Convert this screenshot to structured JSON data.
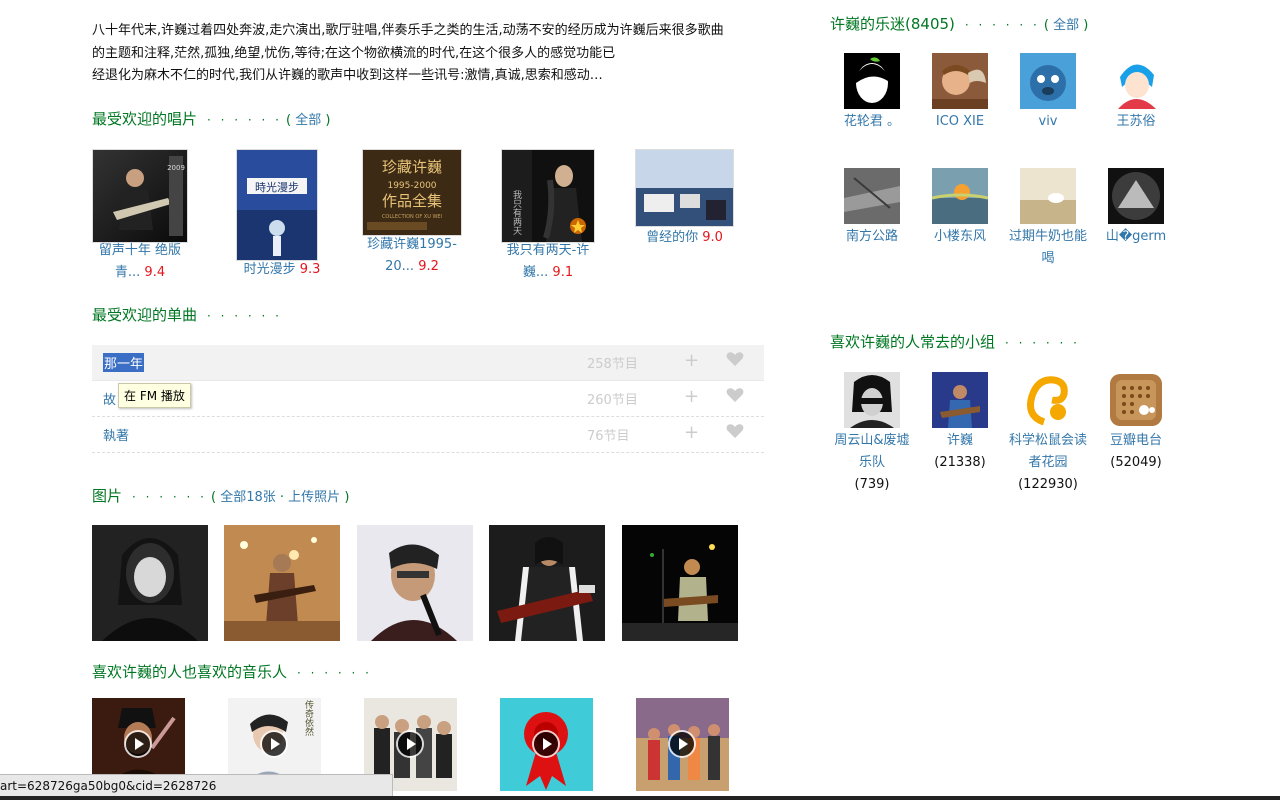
{
  "intro": {
    "line1": "八十年代末,许巍过着四处奔波,走穴演出,歌厅驻唱,伴奏乐手之类的生活,动荡不安的经历成为许巍后来很多歌曲",
    "line2": "的主题和注释,茫然,孤独,绝望,忧伤,等待;在这个物欲横流的时代,在这个很多人的感觉功能已",
    "line3": "经退化为麻木不仁的时代,我们从许巍的歌声中收到这样一些讯号:激情,真诚,思索和感动…"
  },
  "albums_section": {
    "title": "最受欢迎的唱片",
    "dots": "· · · · · ·",
    "open": "(",
    "all_link": "全部",
    "close": ")"
  },
  "albums": [
    {
      "line1": "留声十年 绝版",
      "line2": "青...",
      "rating": "9.4"
    },
    {
      "line1": "时光漫步",
      "line2": "",
      "rating": "9.3"
    },
    {
      "line1": "珍藏许巍1995-",
      "line2": "20...",
      "rating": "9.2"
    },
    {
      "line1": "我只有两天-许",
      "line2": "巍...",
      "rating": "9.1"
    },
    {
      "line1": "曾经的你",
      "line2": "",
      "rating": "9.0"
    }
  ],
  "singles_section": {
    "title": "最受欢迎的单曲",
    "dots": "· · · · · ·"
  },
  "singles": [
    {
      "title": "那一年",
      "count": "258节目"
    },
    {
      "title": "故",
      "count": "260节目"
    },
    {
      "title": "執著",
      "count": "76节目"
    }
  ],
  "tooltip": "在 FM 播放",
  "photos_section": {
    "title": "图片",
    "dots": "· · · · · ·",
    "open": "(",
    "all_link": "全部18张",
    "sep": "·",
    "upload_link": "上传照片",
    "close": ")"
  },
  "musicians_section": {
    "title": "喜欢许巍的人也喜欢的音乐人",
    "dots": "· · · · · ·"
  },
  "fans_section": {
    "title": "许巍的乐迷",
    "count": "(8405)",
    "dots": "· · · · · ·",
    "open": "(",
    "all_link": "全部",
    "close": ")"
  },
  "fans": [
    {
      "name": "花轮君 。"
    },
    {
      "name": "ICO XIE"
    },
    {
      "name": "viv"
    },
    {
      "name": "王苏俗"
    },
    {
      "name": "南方公路"
    },
    {
      "name": "小楼东风"
    },
    {
      "name": "过期牛奶也能喝"
    },
    {
      "name": "山�germ"
    }
  ],
  "groups_section": {
    "title": "喜欢许巍的人常去的小组",
    "dots": "· · · · · ·"
  },
  "groups": [
    {
      "name": "周云山&废墟乐队",
      "count": "(739)"
    },
    {
      "name": "许巍",
      "count": "(21338)"
    },
    {
      "name": "科学松鼠会读者花园",
      "count": "(122930)"
    },
    {
      "name": "豆瓣电台",
      "count": "(52049)"
    }
  ],
  "status_url": "art=628726ga50bg0&cid=2628726",
  "colors": {
    "green": "#007722",
    "link": "#3377aa",
    "rating": "#e4161d"
  }
}
